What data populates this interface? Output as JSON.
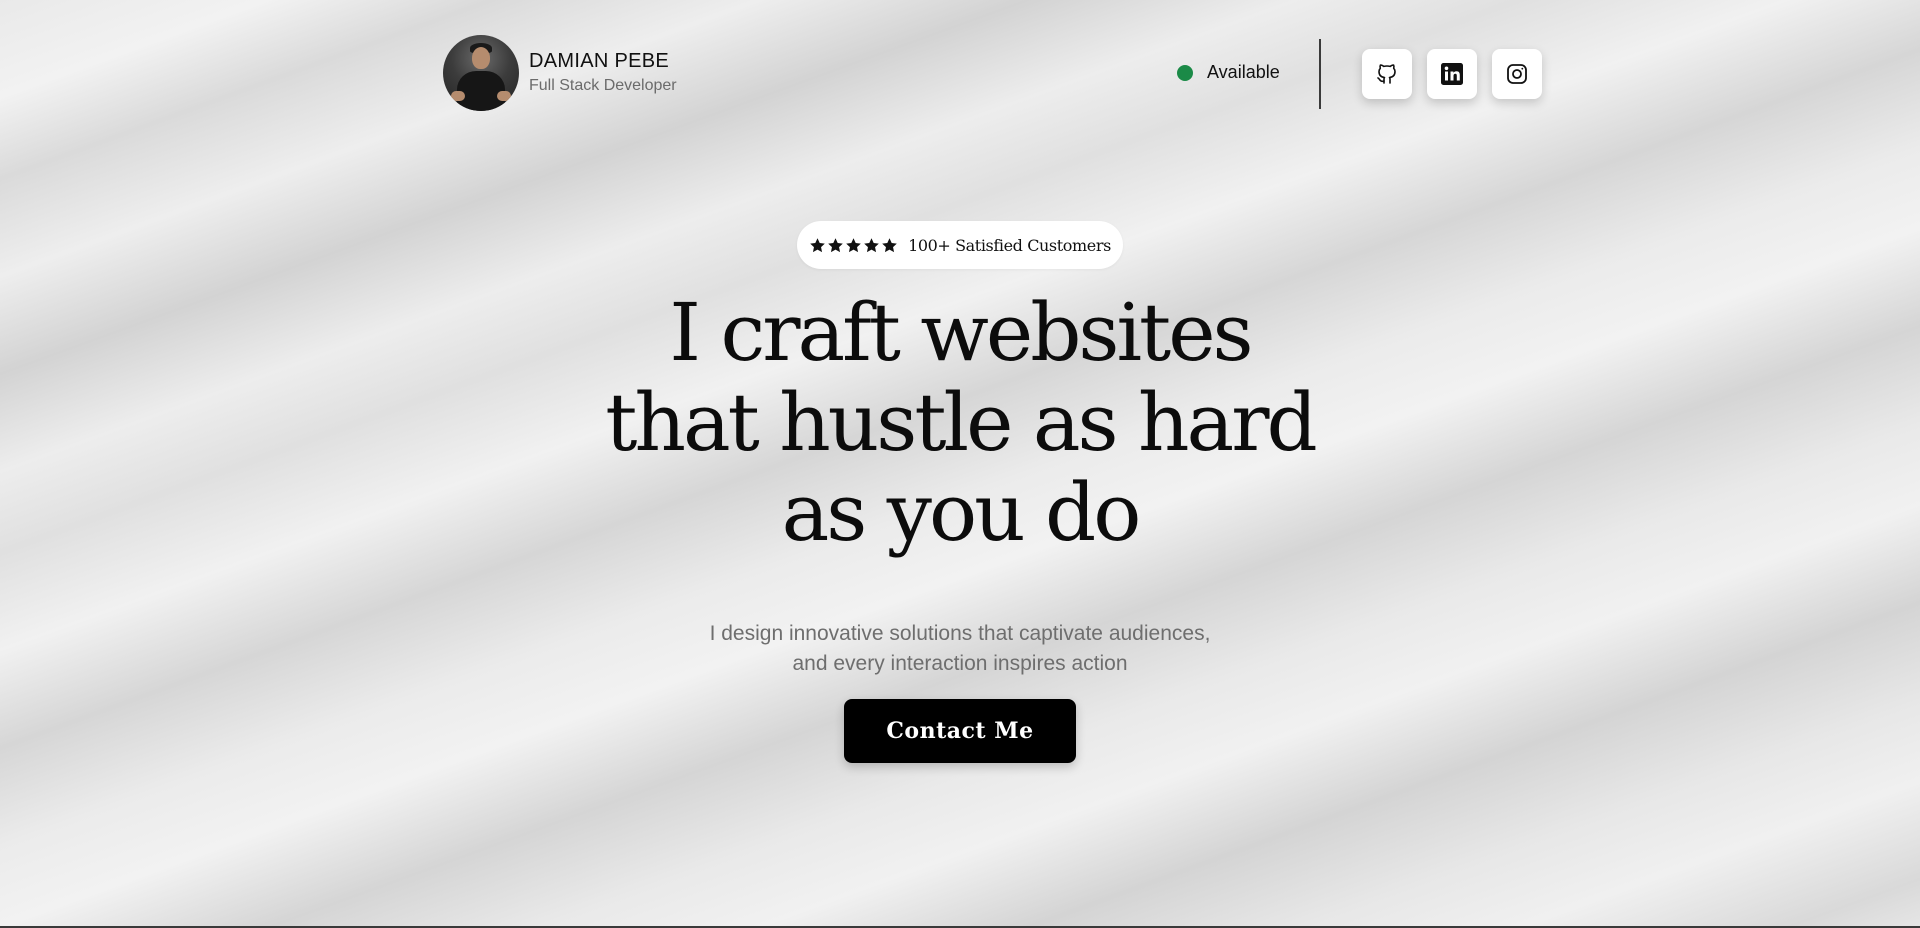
{
  "header": {
    "profile": {
      "name": "DAMIAN PEBE",
      "role": "Full Stack Developer",
      "avatar_icon": "person-photo"
    },
    "availability": {
      "label": "Available",
      "status_color": "#1b8a47"
    },
    "socials": [
      {
        "name": "github",
        "icon": "github-icon"
      },
      {
        "name": "linkedin",
        "icon": "linkedin-icon"
      },
      {
        "name": "instagram",
        "icon": "instagram-icon"
      }
    ]
  },
  "hero": {
    "badge": {
      "rating_stars": 5,
      "text": "100+ Satisfied Customers"
    },
    "headline": {
      "line1": "I craft websites",
      "line2": "that hustle as hard",
      "line3": "as you do"
    },
    "subtext": {
      "line1": "I design innovative solutions that captivate audiences,",
      "line2": "and every interaction inspires action"
    },
    "cta_label": "Contact Me"
  },
  "colors": {
    "text_primary": "#111111",
    "text_muted": "#6e6e6e",
    "button_bg": "#000000",
    "button_text": "#ffffff"
  }
}
